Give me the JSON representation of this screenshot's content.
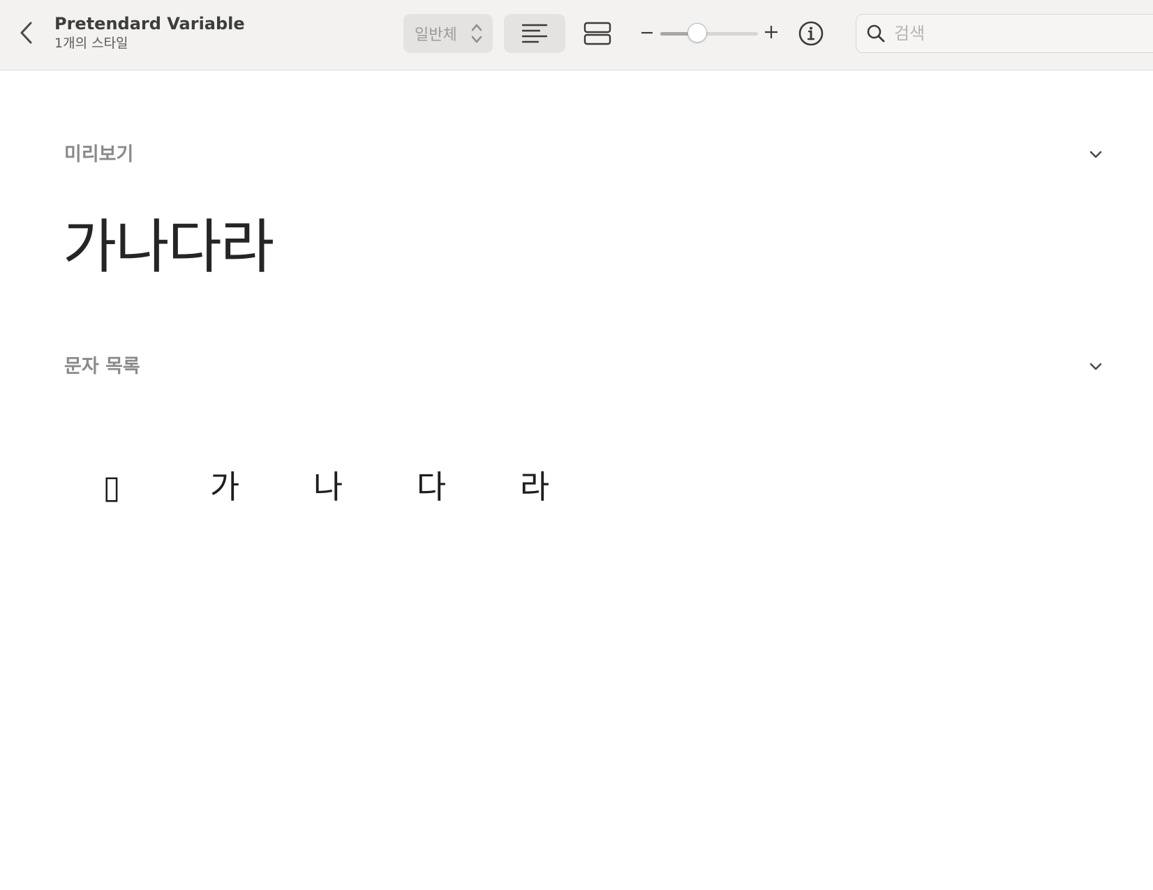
{
  "header": {
    "title": "Pretendard Variable",
    "subtitle": "1개의 스타일",
    "style_select": {
      "value": "일반체"
    },
    "search": {
      "placeholder": "검색",
      "value": ""
    },
    "zoom_level": 0.38
  },
  "sections": {
    "preview": {
      "title": "미리보기",
      "sample_text": "가나다라"
    },
    "charset": {
      "title": "문자 목록"
    }
  },
  "characters": [
    {
      "glyph": "▯"
    },
    {
      "glyph": "가"
    },
    {
      "glyph": "나"
    },
    {
      "glyph": "다"
    },
    {
      "glyph": "라"
    }
  ],
  "icons": {
    "back": "chevron-left-icon",
    "style_select": "chevron-up-down-icon",
    "view_list": "text-align-left-icon",
    "view_grid": "rows-icon",
    "info": "info-circle-icon",
    "search": "search-icon",
    "collapse": "chevron-down-icon"
  },
  "colors": {
    "toolbar_bg": "#f3f2f0",
    "selected_btn_bg": "#e4e3e1",
    "section_title": "#8a8a8a",
    "text": "#252525"
  }
}
